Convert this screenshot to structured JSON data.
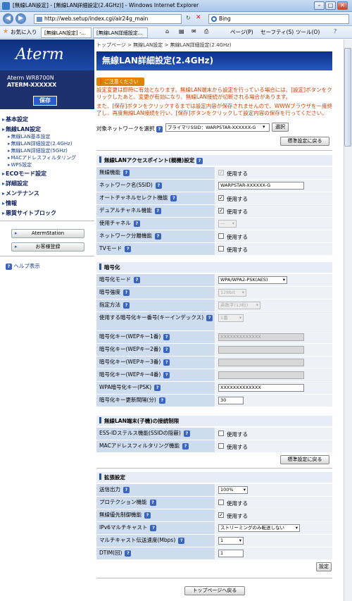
{
  "window": {
    "title": "[無線LAN設定] - [無線LAN詳細設定(2.4GHz)] - Windows Internet Explorer",
    "minimize": "–",
    "maximize": "□",
    "close": "✕"
  },
  "browser": {
    "url": "http://web.setup/index.cgi/air24g_main",
    "search": "Bing",
    "favorites": "お気に入り",
    "tabs": [
      "[無線LAN設定] -...",
      "[無線LAN詳細設定..."
    ],
    "menu": [
      "ページ(P)",
      "セーフティ(S)",
      "ツール(O)"
    ]
  },
  "sidebar": {
    "logo": "Aterm",
    "model": "Aterm WR8700N",
    "product": "ATERM-XXXXXX",
    "save": "保存",
    "groups": [
      {
        "label": "基本設定"
      },
      {
        "label": "無線LAN設定",
        "items": [
          "無線LAN基本設定",
          "無線LAN詳細設定(2.4GHz)",
          "無線LAN詳細設定(5GHz)",
          "MACアドレスフィルタリング",
          "WPS設定"
        ]
      },
      {
        "label": "ECOモード設定"
      },
      {
        "label": "詳細設定"
      },
      {
        "label": "メンテナンス"
      },
      {
        "label": "情報"
      },
      {
        "label": "悪質サイトブロック"
      }
    ],
    "buttons": [
      "AtermStation",
      "お客様登録"
    ],
    "help": "ヘルプ表示"
  },
  "main": {
    "breadcrumb": "トップページ > 無線LAN設定 > 無線LAN詳細設定(2.4GHz)",
    "title": "無線LAN詳細設定(2.4GHz)",
    "notice_badge": "ご注意ください",
    "notice1": "設定変更は即時に有効となります。無線LAN端末から設定を行っている場合には、[設定]ボタンをクリックしたあと、変更が有効になり、無線LAN接続が切断される場合があります。",
    "notice2": "また、[保存]ボタンをクリックするまでは設定内容が保存されませんので、WWWブラウザを一度終了し、再度無線LAN接続を行い、[保存]ボタンをクリックして設定内容の保存を行ってください。",
    "network_label": "対象ネットワークを選択",
    "network_value": "プライマリSSID：WARPSTAR-XXXXXX-G",
    "select_btn": "選択",
    "reset_btn": "標準設定に戻る",
    "sec_ap": "無線LANアクセスポイント(親機)設定",
    "ap_rows": [
      {
        "label": "無線機能",
        "check": "✓",
        "text": "使用する",
        "disabled": true
      },
      {
        "label": "ネットワーク名(SSID)",
        "input": "WARPSTAR-XXXXXX-G"
      },
      {
        "label": "オートチャネルセレクト機能",
        "check": "✓",
        "text": "使用する"
      },
      {
        "label": "デュアルチャネル機能",
        "check": "✓",
        "text": "使用する"
      },
      {
        "label": "使用チャネル",
        "select": "―",
        "disabled": true
      },
      {
        "label": "ネットワーク分離機能",
        "check": "",
        "text": "使用する"
      },
      {
        "label": "TVモード",
        "check": "",
        "text": "使用する"
      }
    ],
    "sec_enc": "暗号化",
    "enc_rows": [
      {
        "label": "暗号化モード",
        "select": "WPA/WPA2-PSK(AES)"
      },
      {
        "label": "暗号強度",
        "select": "128bit",
        "disabled": true
      },
      {
        "label": "指定方法",
        "select": "英数字(13桁)",
        "disabled": true
      },
      {
        "label": "使用する暗号化キー番号(キーインデックス)",
        "select": "1番",
        "disabled": true
      },
      {
        "label": "暗号化キー(WEPキー1番)",
        "input": "XXXXXXXXXXXXX",
        "disabled": true
      },
      {
        "label": "暗号化キー(WEPキー2番)",
        "input": "",
        "disabled": true
      },
      {
        "label": "暗号化キー(WEPキー3番)",
        "input": "",
        "disabled": true
      },
      {
        "label": "暗号化キー(WEPキー4番)",
        "input": "",
        "disabled": true
      },
      {
        "label": "WPA暗号化キー(PSK)",
        "input": "XXXXXXXXXXXXX"
      },
      {
        "label": "暗号化キー更新間隔(分)",
        "input": "30"
      }
    ],
    "sec_conn": "無線LAN端末(子機)の接続制限",
    "conn_rows": [
      {
        "label": "ESS-IDステルス機能(SSIDの隠蔽)",
        "check": "",
        "text": "使用する"
      },
      {
        "label": "MACアドレスフィルタリング機能",
        "check": "",
        "text": "使用する"
      }
    ],
    "sec_ext": "拡張設定",
    "ext_rows": [
      {
        "label": "送信出力",
        "select": "100%"
      },
      {
        "label": "プロテクション機能",
        "check": "",
        "text": "使用する"
      },
      {
        "label": "無線優先制御機能",
        "check": "✓",
        "text": "使用する"
      },
      {
        "label": "IPv6マルチキャスト",
        "select": "ストリーミングのみ転送しない"
      },
      {
        "label": "マルチキャスト伝送速度(Mbps)",
        "select": "1"
      },
      {
        "label": "DTIM(回)",
        "input": "1"
      }
    ],
    "set_btn": "設定",
    "top_btn": "トップページへ戻る"
  }
}
